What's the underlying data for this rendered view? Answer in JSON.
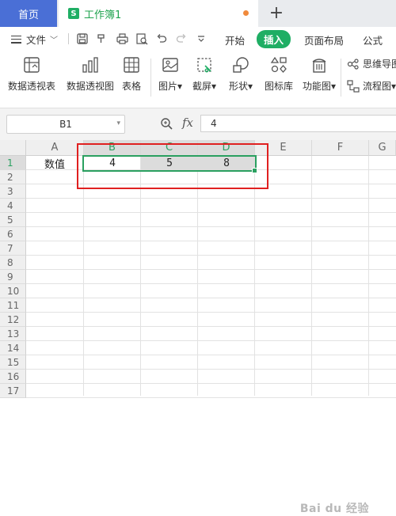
{
  "tabs": {
    "home_label": "首页",
    "doc_icon_letter": "S",
    "doc_title": "工作簿1",
    "new_tab_symbol": "+"
  },
  "menu": {
    "file_label": "文件",
    "items": [
      "开始",
      "插入",
      "页面布局",
      "公式"
    ],
    "active": "插入",
    "quick_access_icons": [
      "save-icon",
      "format-painter-icon",
      "print-icon",
      "print-preview-icon",
      "undo-icon",
      "redo-icon",
      "more-chevron-icon"
    ]
  },
  "ribbon": {
    "buttons": [
      {
        "label": "数据透视表",
        "icon": "pivot-table-icon"
      },
      {
        "label": "数据透视图",
        "icon": "pivot-chart-icon"
      },
      {
        "label": "表格",
        "icon": "table-icon"
      },
      {
        "label": "图片",
        "icon": "picture-icon",
        "dropdown": true
      },
      {
        "label": "截屏",
        "icon": "screenshot-icon",
        "dropdown": true
      },
      {
        "label": "形状",
        "icon": "shapes-icon",
        "dropdown": true
      },
      {
        "label": "图标库",
        "icon": "icon-library-icon"
      },
      {
        "label": "功能图",
        "icon": "function-chart-icon",
        "dropdown": true
      }
    ],
    "side_items": [
      {
        "label": "思维导图",
        "icon": "mindmap-icon"
      },
      {
        "label": "流程图",
        "icon": "flowchart-icon",
        "dropdown": true
      }
    ],
    "dropdown_arrow": "▾"
  },
  "formula_bar": {
    "name_box": "B1",
    "fx_label": "fx",
    "value": "4"
  },
  "sheet": {
    "columns": [
      "A",
      "B",
      "C",
      "D",
      "E",
      "F",
      "G"
    ],
    "selected_columns": [
      "B",
      "C",
      "D"
    ],
    "rows": [
      "1",
      "2",
      "3",
      "4",
      "5",
      "6",
      "7",
      "8",
      "9",
      "10",
      "11",
      "12",
      "13",
      "14",
      "15",
      "16",
      "17"
    ],
    "selected_row": "1",
    "cells": {
      "A1": "数值",
      "B1": "4",
      "C1": "5",
      "D1": "8"
    }
  },
  "colors": {
    "accent_green": "#1fae64",
    "home_tab_blue": "#4a6fd6",
    "highlight_red": "#e02020",
    "selection_green": "#2aa060"
  },
  "watermark": "Bai du 经验"
}
